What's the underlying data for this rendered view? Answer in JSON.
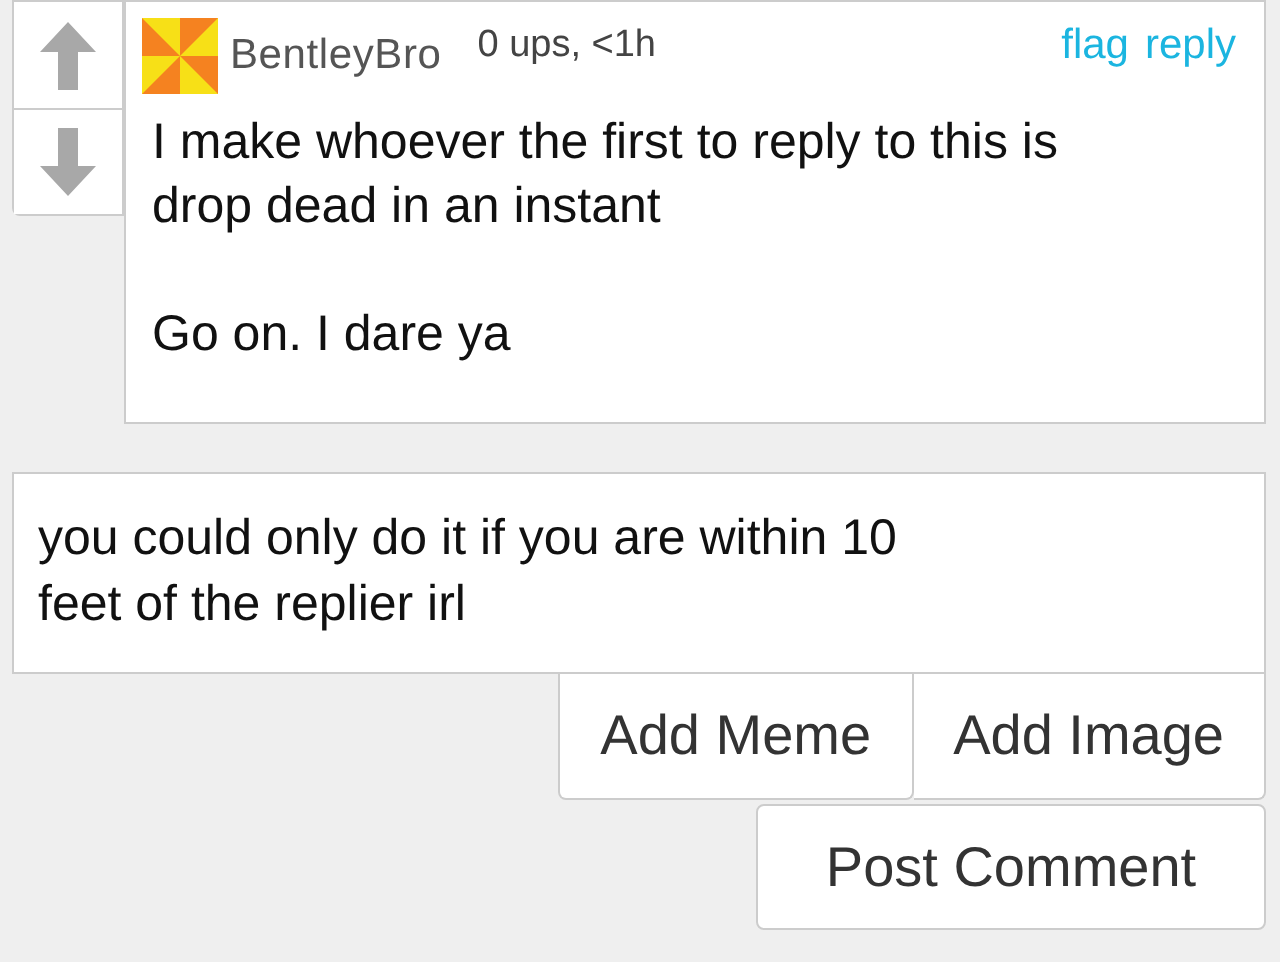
{
  "comment": {
    "username": "BentleyBro",
    "meta": "0 ups, <1h",
    "actions": [
      "flag",
      "reply"
    ],
    "body": "I make whoever the first to reply to this is\ndrop dead in an instant\n\nGo on. I dare ya"
  },
  "reply_field": {
    "value": "you could only do it if you are within 10\nfeet of the replier irl"
  },
  "buttons": [
    "Add Meme",
    "Add Image"
  ],
  "submit": "Post Comment"
}
